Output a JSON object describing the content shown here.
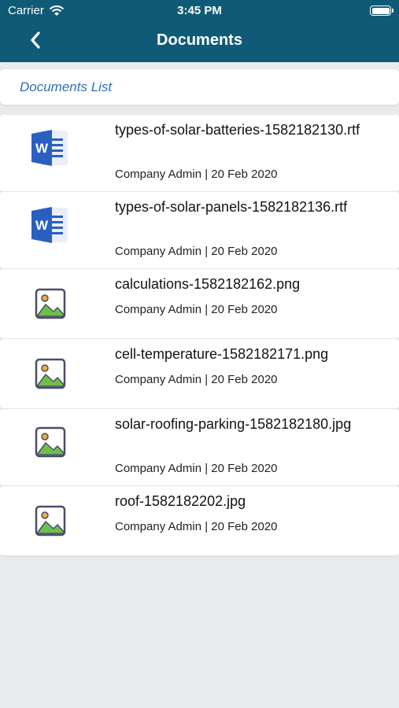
{
  "status_bar": {
    "carrier": "Carrier",
    "time": "3:45 PM"
  },
  "nav": {
    "title": "Documents",
    "back_icon": "chevron-left-icon"
  },
  "section": {
    "title": "Documents List"
  },
  "documents": [
    {
      "name": "types-of-solar-batteries-1582182130.rtf",
      "meta": "Company Admin | 20 Feb 2020",
      "icon": "word-doc-icon"
    },
    {
      "name": "types-of-solar-panels-1582182136.rtf",
      "meta": "Company Admin | 20 Feb 2020",
      "icon": "word-doc-icon"
    },
    {
      "name": "calculations-1582182162.png",
      "meta": "Company Admin | 20 Feb 2020",
      "icon": "image-file-icon"
    },
    {
      "name": "cell-temperature-1582182171.png",
      "meta": "Company Admin | 20 Feb 2020",
      "icon": "image-file-icon"
    },
    {
      "name": "solar-roofing-parking-1582182180.jpg",
      "meta": "Company Admin | 20 Feb 2020",
      "icon": "image-file-icon"
    },
    {
      "name": "roof-1582182202.jpg",
      "meta": "Company Admin | 20 Feb 2020",
      "icon": "image-file-icon"
    }
  ],
  "colors": {
    "header_bg": "#0f5a76",
    "section_title": "#2f6fb5",
    "word_blue": "#2b5fbf",
    "image_green": "#6cc04a"
  }
}
